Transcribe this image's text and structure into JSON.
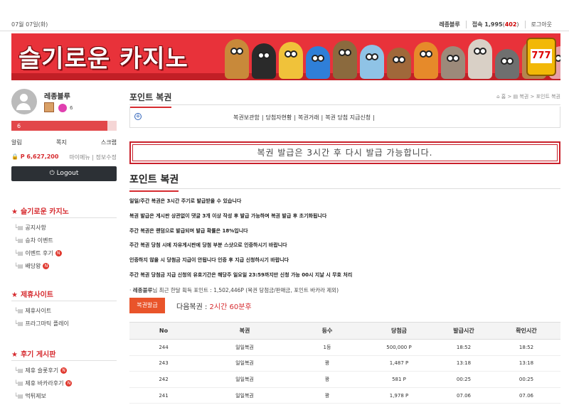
{
  "topbar": {
    "date": "07월 07일(화)",
    "username": "레종블루",
    "visitors_label": "접속 1,995",
    "visitors_count": "402",
    "logout": "로그아웃"
  },
  "banner": {
    "logo": "슬기로운 카지노",
    "slot": "777"
  },
  "sidebar": {
    "user": {
      "name": "레종블루",
      "small_points": "6",
      "level": "6",
      "links": [
        "알림",
        "쪽지",
        "스크랩"
      ],
      "points": "P 6,627,200",
      "my_menu": "마이메뉴",
      "profile_edit": "정보수정",
      "logout": "Logout"
    },
    "sections": [
      {
        "title": "슬기로운 카지노",
        "items": [
          {
            "label": "공지사항",
            "new": ""
          },
          {
            "label": "승차 이벤트",
            "new": ""
          },
          {
            "label": "이벤트 후기",
            "new": "N"
          },
          {
            "label": "배당왕",
            "new": "N"
          }
        ]
      },
      {
        "title": "제휴사이트",
        "items": [
          {
            "label": "제휴사이트",
            "new": ""
          },
          {
            "label": "프라그마틱 플레이",
            "new": ""
          }
        ]
      },
      {
        "title": "후기 게시판",
        "items": [
          {
            "label": "제휴 슬롯후기",
            "new": "N"
          },
          {
            "label": "제휴 바카라후기",
            "new": "N"
          },
          {
            "label": "먹튀제보",
            "new": ""
          }
        ]
      }
    ]
  },
  "main": {
    "title": "포인트 복권",
    "breadcrumb": "⌂ 홈 > ▤ 복권 > 포인트 복권",
    "subnav": [
      "복권보관함",
      "당첨자현황",
      "복권거래",
      "복권 당첨 지급신청"
    ],
    "notice": "복권 발급은 3시간 후 다시 발급 가능합니다.",
    "heading": "포인트 복권",
    "rules": [
      "일일/주간 복권은 3시간 주기로 발급받을 수 있습니다",
      "복권 발급은 게시판 상관없이 댓글 3개 이상 작성 후 발급 가능하며 복권 발급 후 초기화됩니다",
      "주간 복권은 랜덤으로 발급되며 발급 확률은 18%입니다",
      "주간 복권 당첨 시에 자유게시판에 당첨 부분 스샷으로 인증하시기 바랍니다",
      "인증하지 않을 시 당첨금 지급이 안됩니다 인증 후 지급 신청하시기 바랍니다",
      "주간 복권 당첨금 지급 신청의 유효기간은 해당주 일요일 23:59까지만 신청 가능 00시 지날 시 무효 처리"
    ],
    "user_points_name": "레종블루",
    "user_points_text": "님 최근 한달 획득 포인트 : 1,502,446P (복권 당첨금/판매금, 포인트 바카라 제외)",
    "issue_button": "복권발급",
    "next_label": "다음복권 :",
    "next_time": "2시간 60분후",
    "table": {
      "columns": [
        "No",
        "복권",
        "등수",
        "당첨금",
        "발급시간",
        "확인시간"
      ],
      "rows": [
        [
          "244",
          "일일복권",
          "1등",
          "500,000 P",
          "18:52",
          "18:52"
        ],
        [
          "243",
          "일일복권",
          "꽝",
          "1,487 P",
          "13:18",
          "13:18"
        ],
        [
          "242",
          "일일복권",
          "꽝",
          "581 P",
          "00:25",
          "00:25"
        ],
        [
          "241",
          "일일복권",
          "꽝",
          "1,978 P",
          "07.06",
          "07.06"
        ]
      ]
    }
  },
  "colors": {
    "accent": "#d62b2f",
    "banner": "#e8323a",
    "button": "#e9542a",
    "logout_bg": "#2c3035"
  }
}
